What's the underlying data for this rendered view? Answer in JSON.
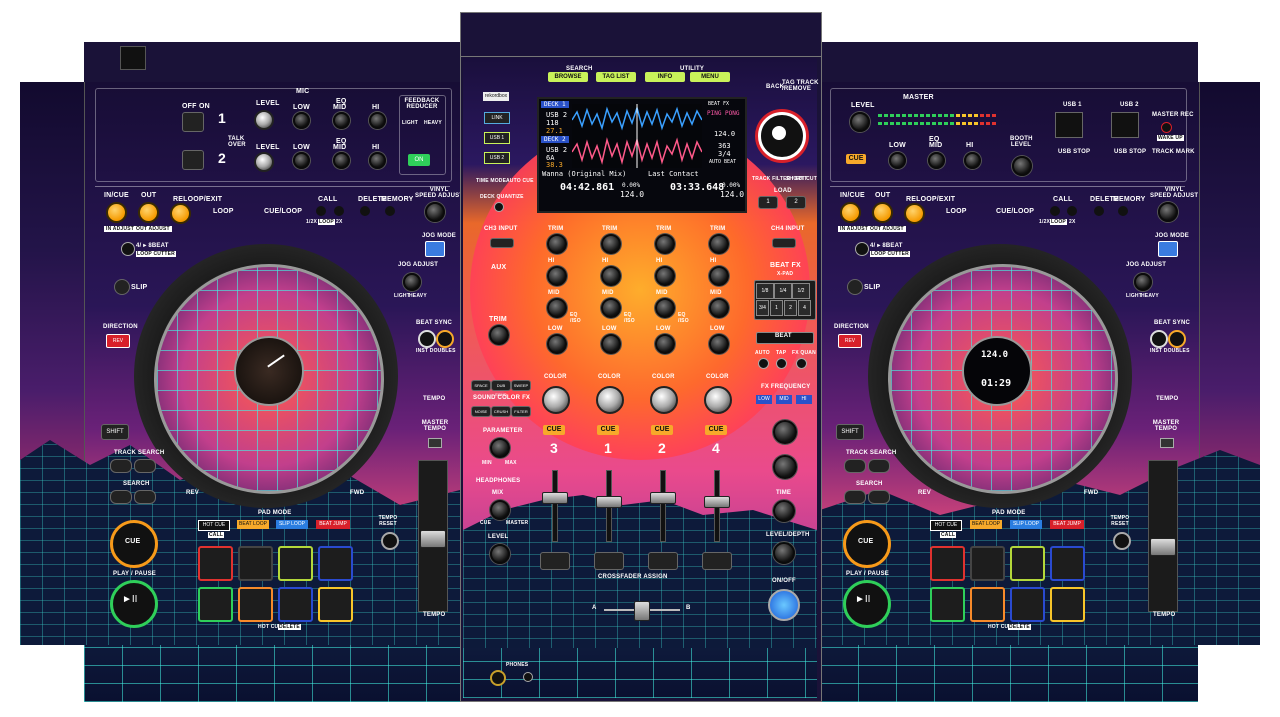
{
  "mixer": {
    "top": {
      "search_group": "SEARCH",
      "utility_group": "UTILITY",
      "browse": "BROWSE",
      "tag_list": "TAG LIST",
      "info": "INFO",
      "menu": "MENU",
      "back": "BACK",
      "tag_track_remove": "TAG TRACK\n/REMOVE",
      "rekordbox": "rekordbox",
      "link": "LINK",
      "usb1": "USB 1",
      "usb2": "USB 2",
      "time_mode": "TIME MODE",
      "auto_cue": "AUTO CUE",
      "deck_quantize": "DECK QUANTIZE",
      "track_filter": "TRACK FILTER / EDIT",
      "short_cut": "SHORT CUT",
      "load": "LOAD",
      "load1": "1",
      "load2": "2"
    },
    "screen": {
      "deck1": "DECK 1",
      "deck1_src": "USB 2",
      "deck1_num": "118",
      "deck1_tempo": "27.1",
      "deck2": "DECK 2",
      "deck2_src": "USB 2",
      "deck2_num": "6A",
      "deck2_val": "38.3",
      "beat_fx": "BEAT FX",
      "ping_pong": "PING PONG",
      "bpm1": "124.0",
      "bpm2": "363",
      "bpm3": "3/4",
      "auto_beat": "AUTO BEAT",
      "track1": "Wanna (Original Mix)",
      "track2": "Last Contact",
      "time1": "04:42.861",
      "time2": "03:33.648",
      "tempo1": "0.00%",
      "tempo1_bpm": "124.0",
      "tempo2": "0.00%",
      "tempo2_bpm": "124.0"
    },
    "ch_input": "CH3 INPUT",
    "ch4_input": "CH4 INPUT",
    "aux": "AUX",
    "trim": "TRIM",
    "hi": "HI",
    "mid": "MID",
    "low": "LOW",
    "eq_iso": "EQ\n/ISO",
    "color": "COLOR",
    "cue": "CUE",
    "channels": [
      "3",
      "1",
      "2",
      "4"
    ],
    "sound_color_fx": "SOUND COLOR FX",
    "space": "SPACE",
    "dub_echo": "DUB ECHO",
    "sweep": "SWEEP",
    "noise": "NOISE",
    "crush": "CRUSH",
    "filter": "FILTER",
    "parameter": "PARAMETER",
    "min": "MIN",
    "max": "MAX",
    "headphones": "HEADPHONES",
    "mix": "MIX",
    "cue_label": "CUE",
    "master": "MASTER",
    "level": "LEVEL",
    "beat_fx": "BEAT FX",
    "x_pad": "X-PAD",
    "xpad_vals": [
      "1/8",
      "1/4",
      "1/2",
      "3/4",
      "1",
      "2",
      "4"
    ],
    "beat": "BEAT",
    "auto": "AUTO",
    "tap": "TAP",
    "fx_quan": "FX QUAN",
    "fx_frequency": "FX FREQUENCY",
    "low_btn": "LOW",
    "mid_btn": "MID",
    "hi_btn": "HI",
    "time": "TIME",
    "level_depth": "LEVEL/DEPTH",
    "on_off": "ON/OFF",
    "crossfader_assign": "CROSSFADER ASSIGN",
    "phones": "PHONES",
    "a": "A",
    "b": "B"
  },
  "mic": {
    "title": "MIC",
    "off": "OFF",
    "on": "ON",
    "ch1": "1",
    "ch2": "2",
    "level": "LEVEL",
    "eq": "EQ",
    "low": "LOW",
    "mid": "MID",
    "hi": "HI",
    "talk_over": "TALK OVER",
    "feedback": "FEEDBACK REDUCER",
    "light": "LIGHT",
    "heavy": "HEAVY",
    "on_btn": "ON"
  },
  "master_section": {
    "title": "MASTER",
    "level": "LEVEL",
    "eq": "EQ",
    "low": "LOW",
    "mid": "MID",
    "hi": "HI",
    "usb1": "USB 1",
    "usb2": "USB 2",
    "usb_stop": "USB STOP",
    "master_rec": "MASTER REC",
    "wake_up": "WAKE UP",
    "track_mark": "TRACK MARK",
    "booth_level": "BOOTH LEVEL",
    "cue": "CUE"
  },
  "decks": [
    {
      "in_cue": "IN/CUE",
      "out": "OUT",
      "reloop": "RELOOP/EXIT",
      "loop": "LOOP",
      "in_adjust": "IN ADJUST",
      "out_adjust": "OUT ADJUST",
      "call": "CALL",
      "delete": "DELETE",
      "memory": "MEMORY",
      "cue_loop": "CUE/LOOP",
      "vinyl": "VINYL\nSPEED ADJUST",
      "jog_mode": "JOG MODE",
      "loop_half": "1/2X",
      "loop_btn": "LOOP",
      "loop_2x": "2X",
      "beat_loop": "4/ ▸ 8BEAT",
      "loop_cutter": "LOOP CUTTER",
      "slip": "SLIP",
      "jog_adjust": "JOG ADJUST",
      "light": "LIGHT",
      "heavy": "HEAVY",
      "direction": "DIRECTION",
      "rev": "REV",
      "beat_sync": "BEAT SYNC",
      "inst_doubles": "INST DOUBLES",
      "tempo": "TEMPO",
      "master_tempo": "MASTER TEMPO",
      "shift": "SHIFT",
      "track_search": "TRACK SEARCH",
      "search": "SEARCH",
      "rev_lbl": "REV",
      "fwd_lbl": "FWD",
      "pad_mode": "PAD MODE",
      "hot_cue": "HOT CUE",
      "beat_loop_pad": "BEAT LOOP",
      "slip_loop": "SLIP LOOP",
      "beat_jump": "BEAT JUMP",
      "call_pad": "CALL",
      "cue": "CUE",
      "play_pause": "PLAY / PAUSE",
      "hot_cue_delete": "HOT CUE",
      "delete_pad": "DELETE",
      "tempo_reset": "TEMPO RESET",
      "tempo_fader": "TEMPO",
      "jog_display_bpm": "",
      "jog_display_time": ""
    },
    {
      "in_cue": "IN/CUE",
      "out": "OUT",
      "reloop": "RELOOP/EXIT",
      "loop": "LOOP",
      "in_adjust": "IN ADJUST",
      "out_adjust": "OUT ADJUST",
      "call": "CALL",
      "delete": "DELETE",
      "memory": "MEMORY",
      "cue_loop": "CUE/LOOP",
      "vinyl": "VINYL\nSPEED ADJUST",
      "jog_mode": "JOG MODE",
      "loop_half": "1/2X",
      "loop_btn": "LOOP",
      "loop_2x": "2X",
      "beat_loop": "4/ ▸ 8BEAT",
      "loop_cutter": "LOOP CUTTER",
      "slip": "SLIP",
      "jog_adjust": "JOG ADJUST",
      "light": "LIGHT",
      "heavy": "HEAVY",
      "direction": "DIRECTION",
      "rev": "REV",
      "beat_sync": "BEAT SYNC",
      "inst_doubles": "INST DOUBLES",
      "tempo": "TEMPO",
      "master_tempo": "MASTER TEMPO",
      "shift": "SHIFT",
      "track_search": "TRACK SEARCH",
      "search": "SEARCH",
      "rev_lbl": "REV",
      "fwd_lbl": "FWD",
      "pad_mode": "PAD MODE",
      "hot_cue": "HOT CUE",
      "beat_loop_pad": "BEAT LOOP",
      "slip_loop": "SLIP LOOP",
      "beat_jump": "BEAT JUMP",
      "call_pad": "CALL",
      "cue": "CUE",
      "play_pause": "PLAY / PAUSE",
      "hot_cue_delete": "HOT CUE",
      "delete_pad": "DELETE",
      "tempo_reset": "TEMPO RESET",
      "tempo_fader": "TEMPO",
      "jog_display_bpm": "124.0",
      "jog_display_time": "01:29"
    }
  ],
  "colors": {
    "accent_yellow": "#c9f25a",
    "cue_orange": "#f7a92a",
    "grid_cyan": "#42f0e1",
    "sun": "#ff5a3c"
  }
}
